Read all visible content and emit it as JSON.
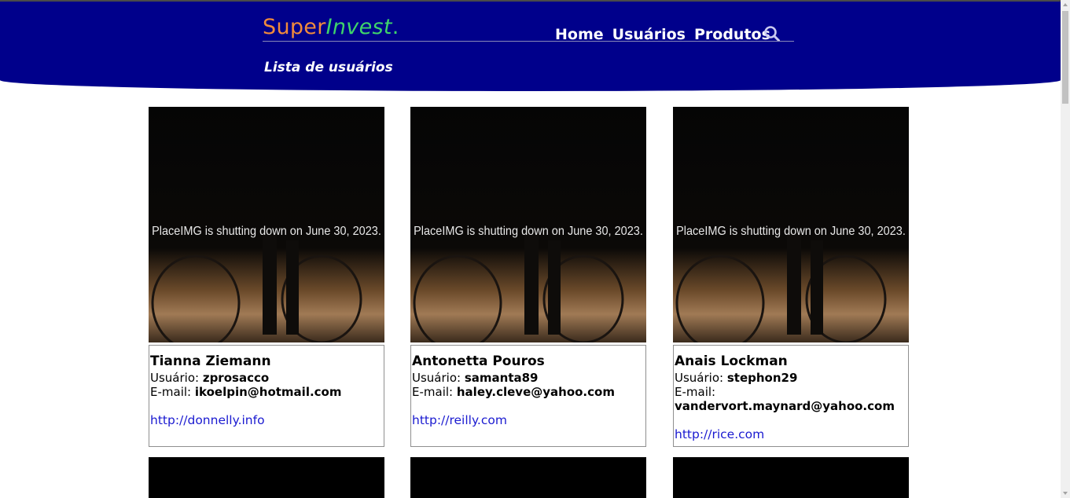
{
  "header": {
    "logo": {
      "part1": "Super",
      "part2": "Invest",
      "part3": "."
    },
    "nav": [
      "Home",
      "Usuários",
      "Produtos"
    ],
    "search_icon": "search-icon",
    "subtitle": "Lista de usuários",
    "colors": {
      "background": "#00008b",
      "logo_orange": "#f08a3c",
      "logo_green": "#3fd46a"
    }
  },
  "users": [
    {
      "name": "Tianna Ziemann",
      "user_label": "Usuário:",
      "username": "zprosacco",
      "email_label": "E-mail:",
      "email": "ikoelpin@hotmail.com",
      "website": "http://donnelly.info",
      "image_text": "PlaceIMG is shutting down on June 30, 2023."
    },
    {
      "name": "Antonetta Pouros",
      "user_label": "Usuário:",
      "username": "samanta89",
      "email_label": "E-mail:",
      "email": "haley.cleve@yahoo.com",
      "website": "http://reilly.com",
      "image_text": "PlaceIMG is shutting down on June 30, 2023."
    },
    {
      "name": "Anais Lockman",
      "user_label": "Usuário:",
      "username": "stephon29",
      "email_label": "E-mail:",
      "email": "vandervort.maynard@yahoo.com",
      "website": "http://rice.com",
      "image_text": "PlaceIMG is shutting down on June 30, 2023."
    }
  ],
  "link_color": "#1a1ad0"
}
